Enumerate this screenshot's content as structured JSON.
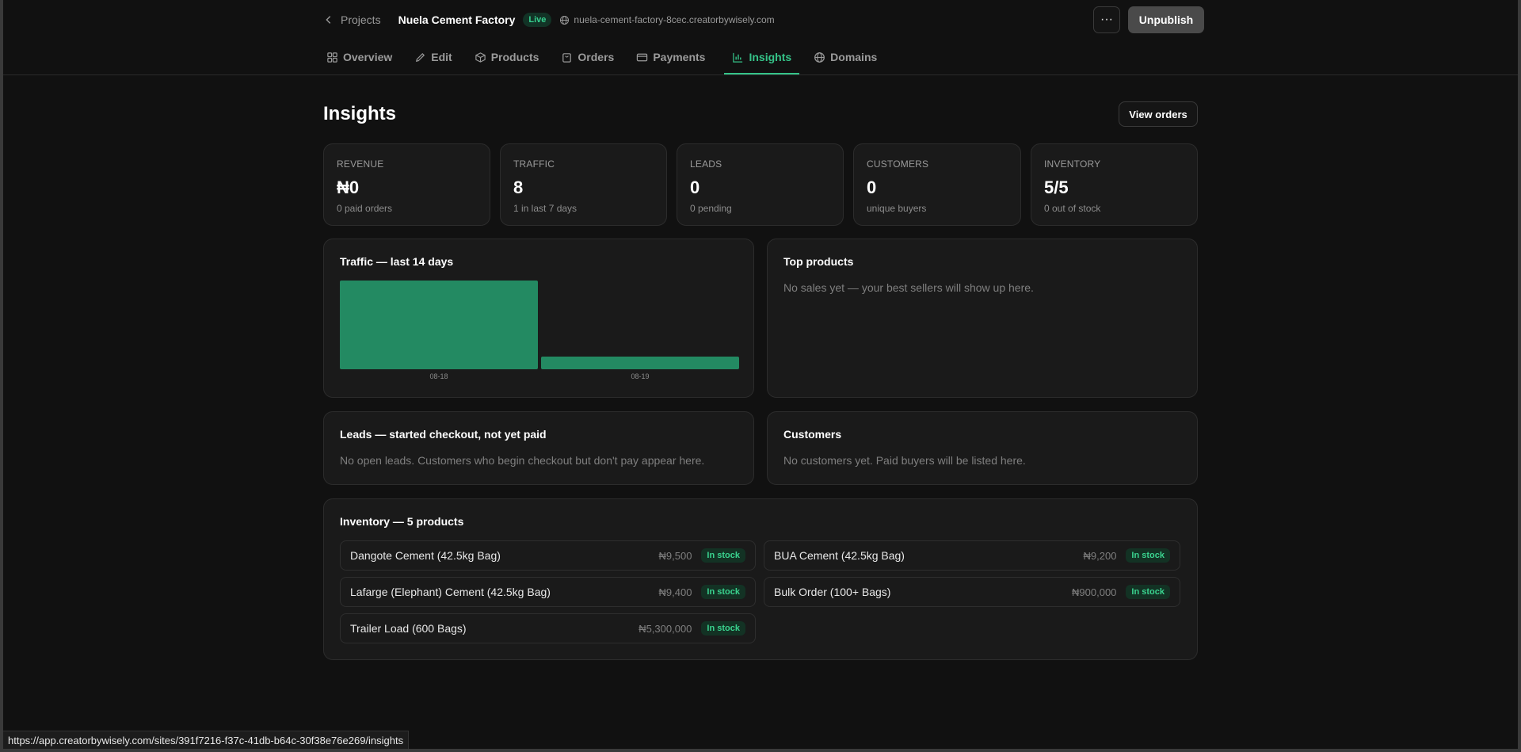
{
  "header": {
    "back_label": "Projects",
    "site_name": "Nuela Cement Factory",
    "live_badge": "Live",
    "url": "nuela-cement-factory-8cec.creatorbywisely.com",
    "more_label": "···",
    "unpublish_label": "Unpublish"
  },
  "tabs": [
    {
      "label": "Overview",
      "icon": "grid-icon",
      "active": false
    },
    {
      "label": "Edit",
      "icon": "pencil-icon",
      "active": false
    },
    {
      "label": "Products",
      "icon": "box-icon",
      "active": false
    },
    {
      "label": "Orders",
      "icon": "bag-icon",
      "active": false
    },
    {
      "label": "Payments",
      "icon": "card-icon",
      "active": false
    },
    {
      "label": "Insights",
      "icon": "bar-chart-icon",
      "active": true
    },
    {
      "label": "Domains",
      "icon": "globe-icon",
      "active": false
    }
  ],
  "page": {
    "title": "Insights",
    "view_orders_label": "View orders"
  },
  "stats": [
    {
      "label": "REVENUE",
      "value": "₦0",
      "sub": "0 paid orders"
    },
    {
      "label": "TRAFFIC",
      "value": "8",
      "sub": "1 in last 7 days"
    },
    {
      "label": "LEADS",
      "value": "0",
      "sub": "0 pending"
    },
    {
      "label": "CUSTOMERS",
      "value": "0",
      "sub": "unique buyers"
    },
    {
      "label": "INVENTORY",
      "value": "5/5",
      "sub": "0 out of stock"
    }
  ],
  "traffic_panel": {
    "title": "Traffic — last 14 days"
  },
  "top_products": {
    "title": "Top products",
    "empty": "No sales yet — your best sellers will show up here."
  },
  "leads": {
    "title": "Leads — started checkout, not yet paid",
    "empty": "No open leads. Customers who begin checkout but don't pay appear here."
  },
  "customers": {
    "title": "Customers",
    "empty": "No customers yet. Paid buyers will be listed here."
  },
  "inventory": {
    "title": "Inventory — 5 products",
    "items": [
      {
        "name": "Dangote Cement (42.5kg Bag)",
        "price": "₦9,500",
        "status": "In stock"
      },
      {
        "name": "BUA Cement (42.5kg Bag)",
        "price": "₦9,200",
        "status": "In stock"
      },
      {
        "name": "Lafarge (Elephant) Cement (42.5kg Bag)",
        "price": "₦9,400",
        "status": "In stock"
      },
      {
        "name": "Bulk Order (100+ Bags)",
        "price": "₦900,000",
        "status": "In stock"
      },
      {
        "name": "Trailer Load (600 Bags)",
        "price": "₦5,300,000",
        "status": "In stock"
      }
    ]
  },
  "chart_data": {
    "type": "bar",
    "title": "Traffic — last 14 days",
    "categories": [
      "08-18",
      "08-19"
    ],
    "values": [
      7,
      1
    ],
    "color": "#238a62",
    "xlabel": "",
    "ylabel": ""
  },
  "statusbar": {
    "url": "https://app.creatorbywisely.com/sites/391f7216-f37c-41db-b64c-30f38e76e269/insights"
  },
  "colors": {
    "accent": "#35c489",
    "background": "#111111",
    "card": "#1a1a1a"
  }
}
